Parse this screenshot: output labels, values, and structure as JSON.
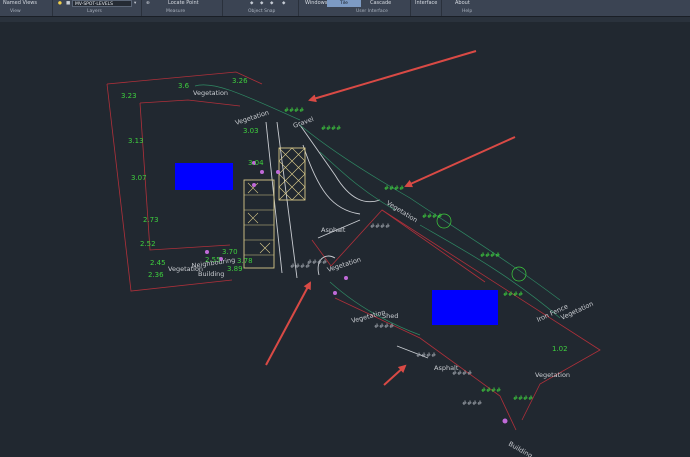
{
  "ribbon": {
    "named_views": "Named Views",
    "layer_combo": "MV-SPOT-LEVELS",
    "locate_point": "Locate Point",
    "windows": "Windows",
    "tile": "Tile",
    "cascade": "Cascade",
    "interface": "Interface",
    "about": "About",
    "panels": {
      "view": "View",
      "layers": "Layers",
      "measure": "Measure",
      "object_snap": "Object Snap",
      "user_interface": "User Interface",
      "help": "Help"
    }
  },
  "drawing": {
    "spot_levels": [
      "3.6",
      "3.26",
      "3.23",
      "3.13",
      "3.07",
      "3.03",
      "3.04",
      "2.73",
      "2.52",
      "2.36",
      "2.45",
      "2.55",
      "3.70",
      "3.78",
      "3.89",
      "1.02"
    ],
    "hash_marks": [
      "####",
      "####",
      "####",
      "####",
      "####",
      "####",
      "####",
      "####",
      "####",
      "####",
      "####",
      "####",
      "####",
      "####",
      "####"
    ],
    "area_labels": {
      "vegetation_1": "Vegetation",
      "vegetation_2": "Vegetation",
      "vegetation_3": "Vegetation",
      "vegetation_4": "Vegetation",
      "vegetation_5": "Vegetation",
      "vegetation_6": "Vegetation",
      "vegetation_7": "Vegetation",
      "vegetation_8": "Vegetation",
      "asphalt_1": "Asphalt",
      "asphalt_2": "Asphalt",
      "building_1": "Building",
      "building_2": "Building",
      "gravel": "Gravel",
      "iron_fence": "Iron Fence",
      "neighbouring": "Neighbouring",
      "shed": "Shed"
    },
    "colors": {
      "background": "#212830",
      "boundary": "#b0303a",
      "levels": "#3ecf3e",
      "blue_block": "#0000ff",
      "arrow": "#d94a45",
      "grey_line": "#c9ccd1",
      "hatch": "#d8c98a"
    }
  }
}
